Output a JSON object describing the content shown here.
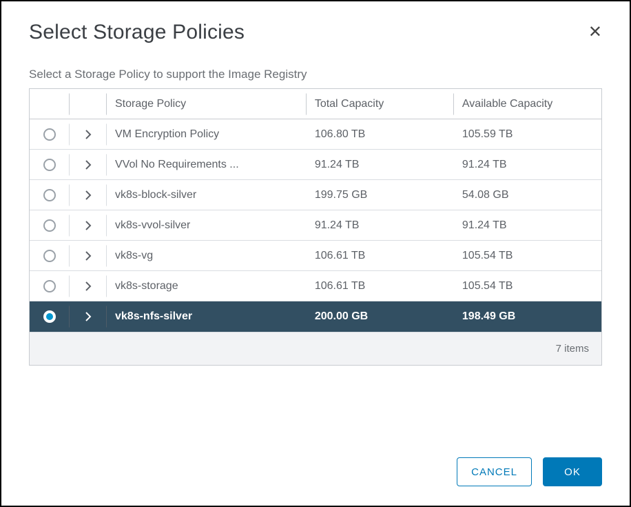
{
  "dialog": {
    "title": "Select Storage Policies",
    "closeGlyph": "✕",
    "subtitle": "Select a Storage Policy to support the Image Registry"
  },
  "table": {
    "headers": {
      "policy": "Storage Policy",
      "total": "Total Capacity",
      "avail": "Available Capacity"
    },
    "rows": [
      {
        "policy": "VM Encryption Policy",
        "total": "106.80 TB",
        "avail": "105.59 TB",
        "selected": false
      },
      {
        "policy": "VVol No Requirements ...",
        "total": "91.24 TB",
        "avail": "91.24 TB",
        "selected": false
      },
      {
        "policy": "vk8s-block-silver",
        "total": "199.75 GB",
        "avail": "54.08 GB",
        "selected": false
      },
      {
        "policy": "vk8s-vvol-silver",
        "total": "91.24 TB",
        "avail": "91.24 TB",
        "selected": false
      },
      {
        "policy": "vk8s-vg",
        "total": "106.61 TB",
        "avail": "105.54 TB",
        "selected": false
      },
      {
        "policy": "vk8s-storage",
        "total": "106.61 TB",
        "avail": "105.54 TB",
        "selected": false
      },
      {
        "policy": "vk8s-nfs-silver",
        "total": "200.00 GB",
        "avail": "198.49 GB",
        "selected": true
      }
    ],
    "footer": "7 items"
  },
  "actions": {
    "cancel": "CANCEL",
    "ok": "OK"
  }
}
